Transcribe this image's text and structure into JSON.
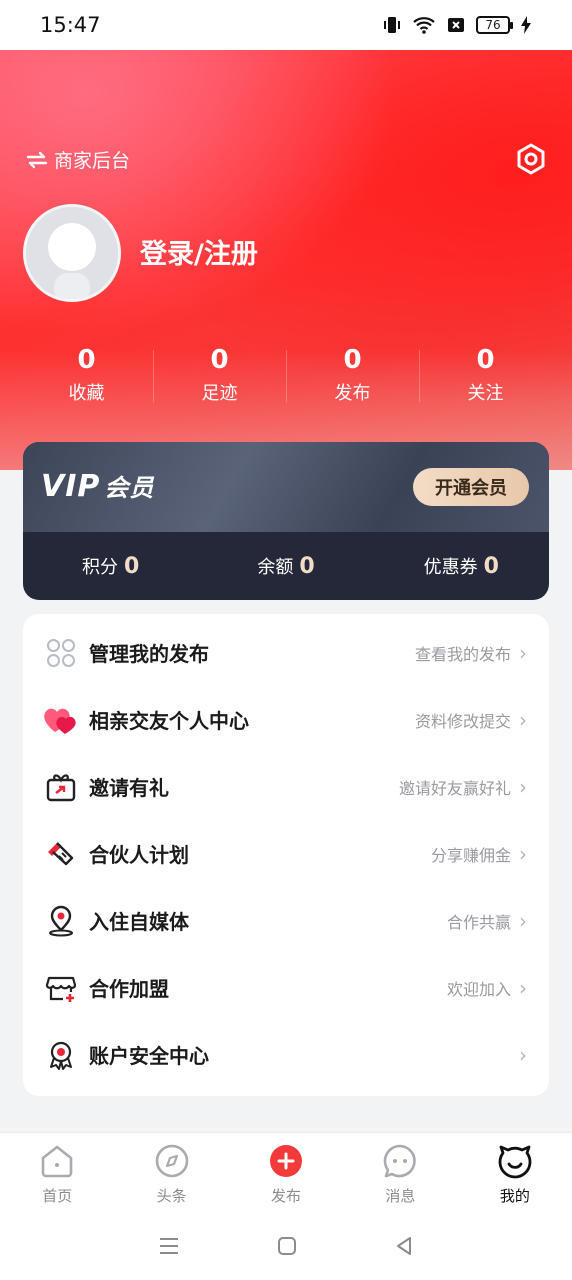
{
  "status_bar": {
    "time": "15:47",
    "battery": "76"
  },
  "header": {
    "merchant_label": "商家后台",
    "login_label": "登录/注册"
  },
  "stats": [
    {
      "value": "0",
      "label": "收藏"
    },
    {
      "value": "0",
      "label": "足迹"
    },
    {
      "value": "0",
      "label": "发布"
    },
    {
      "value": "0",
      "label": "关注"
    }
  ],
  "vip": {
    "title": "VIP",
    "title_cn": "会员",
    "button_label": "开通会员",
    "items": [
      {
        "label": "积分",
        "value": "0"
      },
      {
        "label": "余额",
        "value": "0"
      },
      {
        "label": "优惠券",
        "value": "0"
      }
    ]
  },
  "menu": [
    {
      "label": "管理我的发布",
      "hint": "查看我的发布",
      "icon": "grid-icon"
    },
    {
      "label": "相亲交友个人中心",
      "hint": "资料修改提交",
      "icon": "hearts-icon"
    },
    {
      "label": "邀请有礼",
      "hint": "邀请好友赢好礼",
      "icon": "gift-icon"
    },
    {
      "label": "合伙人计划",
      "hint": "分享赚佣金",
      "icon": "handshake-icon"
    },
    {
      "label": "入住自媒体",
      "hint": "合作共赢",
      "icon": "location-pin-icon"
    },
    {
      "label": "合作加盟",
      "hint": "欢迎加入",
      "icon": "store-plus-icon"
    },
    {
      "label": "账户安全中心",
      "hint": "",
      "icon": "badge-icon"
    }
  ],
  "tabs": [
    {
      "label": "首页",
      "icon": "home-icon"
    },
    {
      "label": "头条",
      "icon": "compass-icon"
    },
    {
      "label": "发布",
      "icon": "plus-icon"
    },
    {
      "label": "消息",
      "icon": "chat-icon"
    },
    {
      "label": "我的",
      "icon": "face-icon"
    }
  ],
  "colors": {
    "accent": "#ff3a3a",
    "vip_gold": "#f3dcc6",
    "vip_dark": "#252838"
  }
}
